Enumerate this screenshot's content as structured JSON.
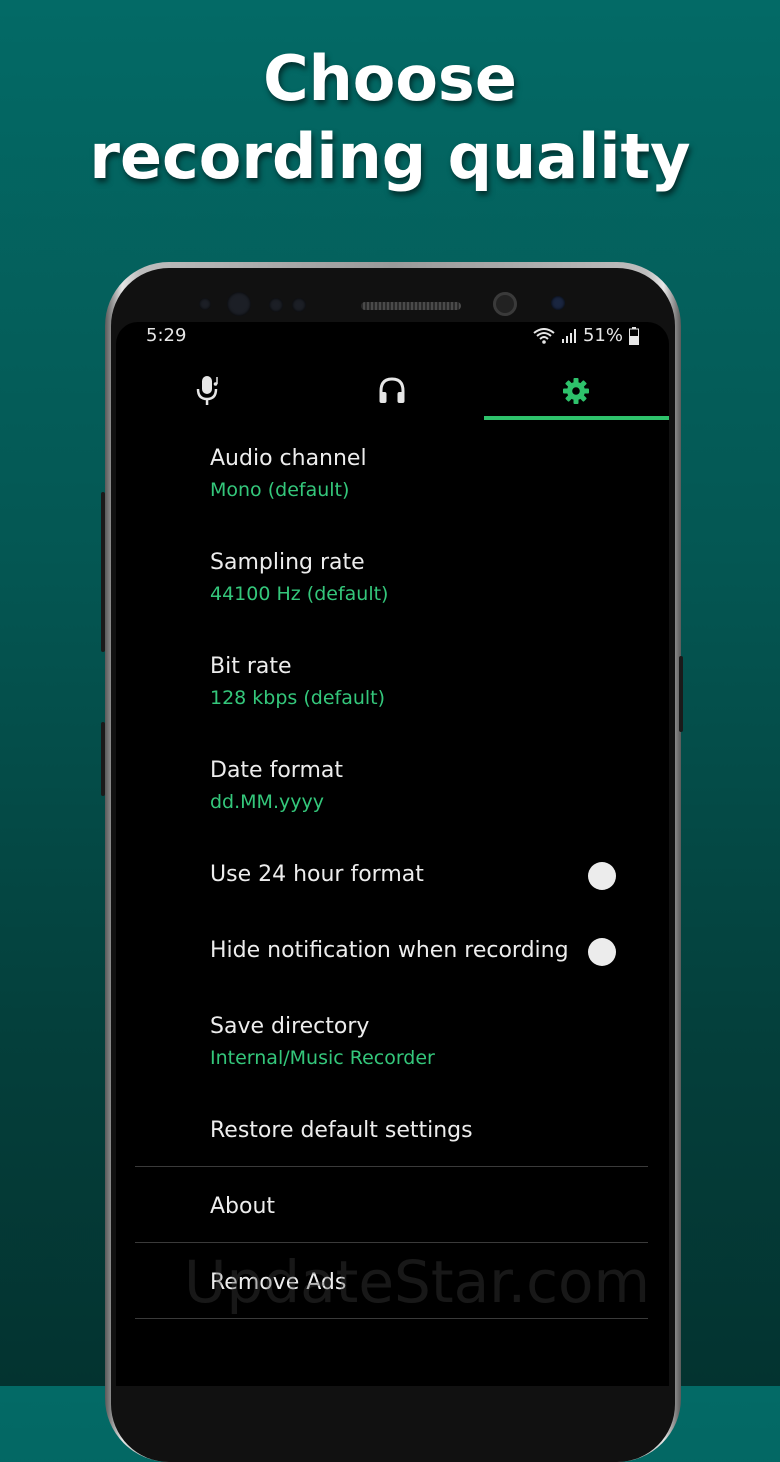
{
  "headline": {
    "line1": "Choose",
    "line2": "recording quality"
  },
  "status_bar": {
    "time": "5:29",
    "battery": "51%"
  },
  "tabs": [
    {
      "icon": "microphone-icon",
      "active": false
    },
    {
      "icon": "headphones-icon",
      "active": false
    },
    {
      "icon": "gear-icon",
      "active": true
    }
  ],
  "colors": {
    "accent": "#2ec26b",
    "value_text": "#34c77b",
    "background_top": "#036a66"
  },
  "settings": {
    "audio_channel": {
      "title": "Audio channel",
      "value": "Mono (default)"
    },
    "sampling_rate": {
      "title": "Sampling rate",
      "value": "44100 Hz (default)"
    },
    "bit_rate": {
      "title": "Bit rate",
      "value": "128 kbps (default)"
    },
    "date_format": {
      "title": "Date format",
      "value": "dd.MM.yyyy"
    },
    "use_24_hour": {
      "title": "Use 24 hour format",
      "enabled": false
    },
    "hide_notification": {
      "title": "Hide notification when recording",
      "enabled": false
    },
    "save_directory": {
      "title": "Save directory",
      "value": "Internal/Music Recorder"
    },
    "restore_defaults": {
      "title": "Restore default settings"
    },
    "about": {
      "title": "About"
    },
    "remove_ads": {
      "title": "Remove Ads"
    }
  },
  "watermark": "UpdateStar.com"
}
